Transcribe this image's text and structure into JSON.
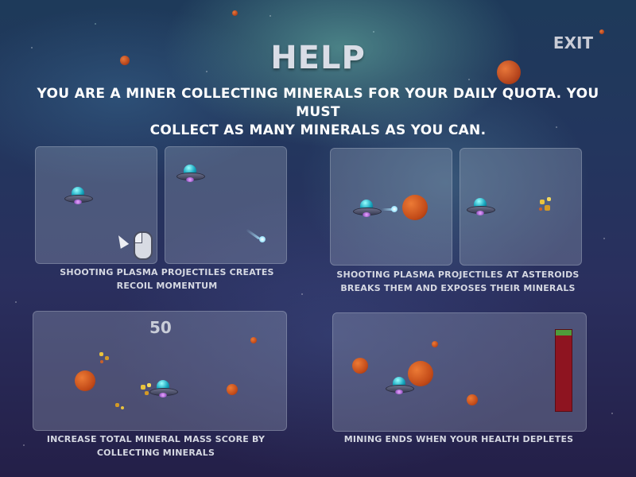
{
  "screen": {
    "title": "HELP",
    "exit_label": "EXIT",
    "intro_line1": "YOU ARE A MINER COLLECTING MINERALS FOR YOUR DAILY QUOTA. YOU MUST",
    "intro_line2": "COLLECT AS MANY MINERALS AS YOU CAN."
  },
  "tutorials": [
    {
      "caption_line1": "SHOOTING PLASMA PROJECTILES CREATES",
      "caption_line2": "RECOIL MOMENTUM"
    },
    {
      "caption_line1": "SHOOTING PLASMA PROJECTILES AT ASTEROIDS",
      "caption_line2": "BREAKS THEM AND EXPOSES THEIR MINERALS"
    },
    {
      "caption_line1": "INCREASE TOTAL MINERAL MASS SCORE BY",
      "caption_line2": "COLLECTING MINERALS",
      "score": "50"
    },
    {
      "caption_line1": "MINING ENDS WHEN YOUR HEALTH DEPLETES",
      "health_fraction": 0.07
    }
  ],
  "icons": [
    "ship-icon",
    "asteroid-icon",
    "mineral-icon",
    "plasma-projectile-icon",
    "mouse-icon",
    "cursor-icon"
  ],
  "colors": {
    "asteroid": "#c24a18",
    "mineral": "#e9c33c",
    "health_bar": "#8e1420",
    "health_fill": "#4f9b3a"
  }
}
